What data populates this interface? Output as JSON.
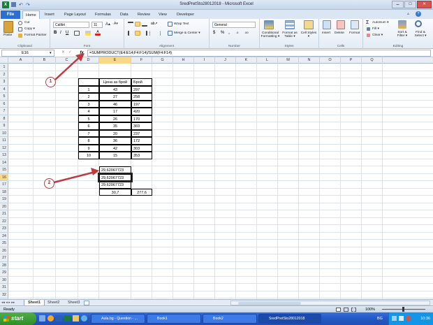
{
  "window": {
    "title": "SredPretSto28012018 - Microsoft Excel"
  },
  "tabs": [
    "File",
    "Home",
    "Insert",
    "Page Layout",
    "Formulas",
    "Data",
    "Review",
    "View",
    "Developer"
  ],
  "active_tab": "Home",
  "ribbon": {
    "clipboard": {
      "label": "Clipboard",
      "paste": "Paste",
      "cut": "Cut",
      "copy": "Copy ▾",
      "painter": "Format Painter"
    },
    "font": {
      "label": "Font",
      "name": "Calibri",
      "size": "11",
      "bold": "B",
      "italic": "I",
      "underline": "U"
    },
    "alignment": {
      "label": "Alignment",
      "wrap": "Wrap Text",
      "merge": "Merge & Center ▾"
    },
    "number": {
      "label": "Number",
      "format": "General",
      "currency": "$",
      "percent": "%",
      "comma": ","
    },
    "styles": {
      "label": "Styles",
      "conditional": "Conditional Formatting ▾",
      "as_table": "Format as Table ▾",
      "cell_styles": "Cell Styles ▾"
    },
    "cells": {
      "label": "Cells",
      "insert": "Insert",
      "delete": "Delete",
      "format": "Format"
    },
    "editing": {
      "label": "Editing",
      "autosum": "AutoSum ▾",
      "fill": "Fill ▾",
      "clear": "Clear ▾",
      "sort": "Sort & Filter ▾",
      "find": "Find & Select ▾"
    }
  },
  "formula_bar": {
    "name_box": "E16",
    "fx": "fx",
    "formula": "=SUMPRODUCT(E4:E14;F4:F14)/SUM(F4:F14)"
  },
  "columns": [
    "A",
    "B",
    "C",
    "D",
    "E",
    "F",
    "G",
    "H",
    "I",
    "J",
    "K",
    "L",
    "M",
    "N",
    "O",
    "P",
    "Q"
  ],
  "rows": [
    "1",
    "2",
    "3",
    "4",
    "5",
    "6",
    "7",
    "8",
    "9",
    "10",
    "11",
    "12",
    "13",
    "14",
    "15",
    "16",
    "17",
    "18",
    "19",
    "20",
    "21",
    "22",
    "23",
    "24",
    "25",
    "26",
    "27",
    "28",
    "29",
    "30",
    "31",
    "32"
  ],
  "table": {
    "headers": [
      "Цена за брой",
      "Брой"
    ],
    "rows": [
      [
        "1",
        "43",
        "297"
      ],
      [
        "2",
        "27",
        "258"
      ],
      [
        "3",
        "46",
        "197"
      ],
      [
        "4",
        "17",
        "420"
      ],
      [
        "5",
        "26",
        "170"
      ],
      [
        "6",
        "35",
        "369"
      ],
      [
        "7",
        "20",
        "237"
      ],
      [
        "8",
        "36",
        "172"
      ],
      [
        "9",
        "42",
        "303"
      ],
      [
        "10",
        "15",
        "353"
      ]
    ]
  },
  "results": {
    "e15": "29,62067723",
    "e16": "29,62067723",
    "e17": "29,62067723",
    "e18": "30,7",
    "f18": "277,6"
  },
  "callouts": [
    "1",
    "2"
  ],
  "sheets": [
    "Sheet1",
    "Sheet2",
    "Sheet3"
  ],
  "active_sheet": "Sheet1",
  "status": {
    "ready": "Ready",
    "zoom": "100%"
  },
  "taskbar": {
    "start": "start",
    "items": [
      "Aula.bg - Question - ...",
      "Book1",
      "Book2",
      "SredPretSto28012018"
    ],
    "lang": "BG",
    "time": "10:36"
  },
  "colors": {
    "file_tab": "#2d6fcc",
    "callout": "#c0393d",
    "taskbar": "#245bc8",
    "start": "#3b9a33"
  }
}
